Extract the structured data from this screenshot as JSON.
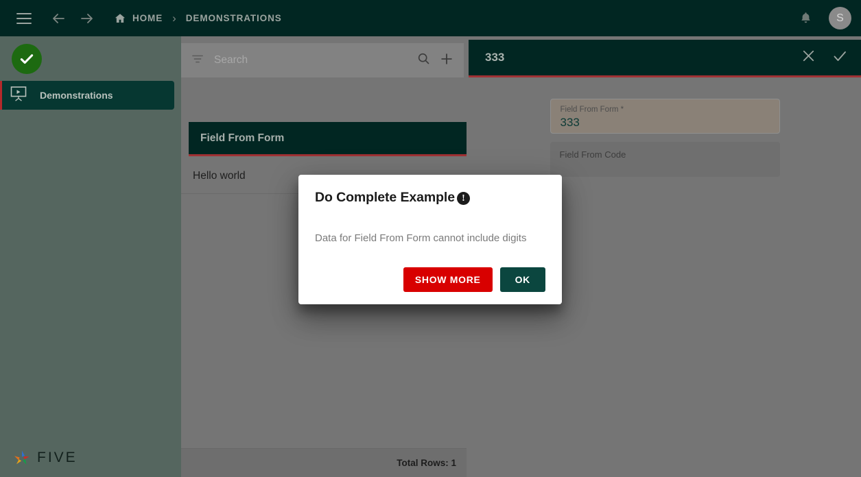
{
  "topbar": {
    "menu_icon": "hamburger-icon",
    "back_icon": "arrow-left-icon",
    "forward_icon": "arrow-right-icon",
    "home_icon": "home-icon",
    "home_label": "HOME",
    "breadcrumb_separator": "›",
    "current_label": "DEMONSTRATIONS",
    "notification_icon": "bell-icon",
    "avatar_initial": "S",
    "background_color": "#012622"
  },
  "sidebar": {
    "logo_icon": "check-circle-icon",
    "items": [
      {
        "label": "Demonstrations",
        "icon": "presentation-icon",
        "active": true
      }
    ],
    "brand": {
      "icon": "five-star-icon",
      "text": "FIVE"
    },
    "background_color": "#55665f",
    "active_accent_color": "#b4292b"
  },
  "list_panel": {
    "search": {
      "filter_icon": "filter-icon",
      "placeholder": "Search",
      "value": "",
      "search_icon": "search-icon",
      "add_icon": "plus-icon"
    },
    "header_title": "Field From Form",
    "rows": [
      {
        "text": "Hello world"
      }
    ],
    "footer_text": "Total Rows: 1",
    "header_accent_color": "#a03134"
  },
  "detail_panel": {
    "title": "333",
    "close_icon": "close-icon",
    "confirm_icon": "check-icon",
    "fields": [
      {
        "label": "Field From Form *",
        "value": "333",
        "state": "filled"
      },
      {
        "label": "Field From Code",
        "value": "",
        "state": "empty"
      }
    ]
  },
  "dialog": {
    "title": "Do Complete Example",
    "warning_icon": "exclamation-circle-icon",
    "warning_glyph": "!",
    "message": "Data for Field From Form cannot include digits",
    "buttons": {
      "secondary_label": "SHOW MORE",
      "primary_label": "OK"
    },
    "secondary_color": "#d80000",
    "primary_color": "#0b463f"
  }
}
